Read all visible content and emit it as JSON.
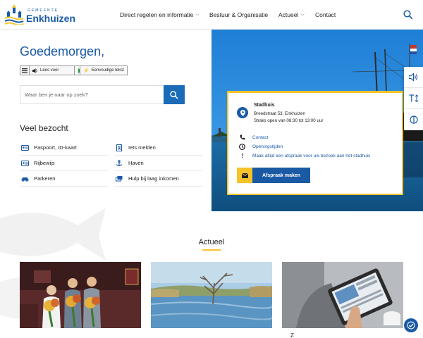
{
  "header": {
    "logo_small": "GEMEENTE",
    "logo_big": "Enkhuizen",
    "nav": [
      {
        "label": "Direct regelen en informatie",
        "has_dropdown": true
      },
      {
        "label": "Bestuur & Organisatie",
        "has_dropdown": false
      },
      {
        "label": "Actueel",
        "has_dropdown": true
      },
      {
        "label": "Contact",
        "has_dropdown": false
      }
    ]
  },
  "hero": {
    "greeting": "Goedemorgen,",
    "readspeaker_label": "Lees voor",
    "simple_text_label": "Eenvoudige tekst",
    "search_placeholder": "Waar ben je naar op zoek?"
  },
  "veel_bezocht": {
    "title": "Veel bezocht",
    "items": [
      {
        "label": "Paspoort, ID-kaart",
        "icon": "id-card-icon"
      },
      {
        "label": "Iets melden",
        "icon": "report-icon"
      },
      {
        "label": "Rijbewijs",
        "icon": "drivers-license-icon"
      },
      {
        "label": "Haven",
        "icon": "anchor-icon"
      },
      {
        "label": "Parkeren",
        "icon": "car-icon"
      },
      {
        "label": "Hulp bij laag inkomen",
        "icon": "money-icon"
      }
    ]
  },
  "info_card": {
    "title": "Stadhuis",
    "address": "Breedstraat 53, Enkhuizen",
    "hours": "Straks open van 08:30 tot 13:00 uur",
    "links": [
      {
        "label": "Contact",
        "icon": "phone-icon"
      },
      {
        "label": "Openingstijden",
        "icon": "clock-icon"
      },
      {
        "label": "Maak altijd een afspraak voor uw bezoek aan het stadhuis",
        "icon": "exclamation-icon"
      }
    ],
    "button_label": "Afspraak maken"
  },
  "actueel": {
    "title": "Actueel",
    "news_title_partial": "Z"
  },
  "colors": {
    "primary": "#1a5aa5",
    "accent": "#f6c32b",
    "search_button": "#1a6bb8"
  }
}
